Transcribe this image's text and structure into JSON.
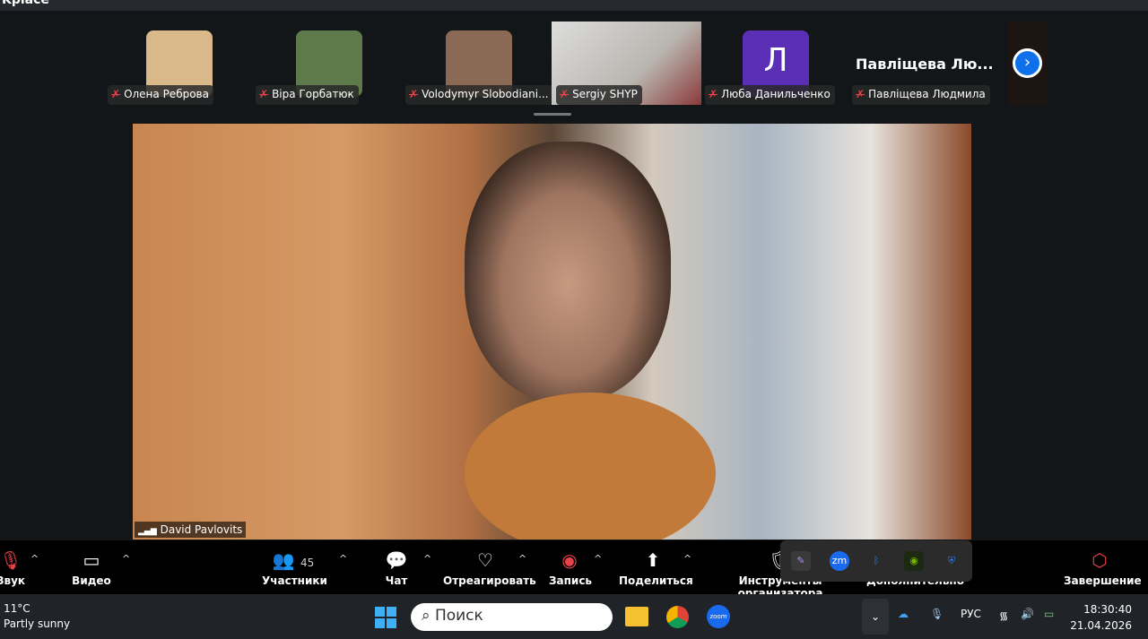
{
  "window": {
    "title": "Kpiace"
  },
  "participants": [
    {
      "name": "Олена Реброва",
      "color": "#d9b98a"
    },
    {
      "name": "Віра Горбатюк",
      "color": "#5e7a4a"
    },
    {
      "name": "Volodymyr Slobodiani...",
      "color": "#8a6a55"
    },
    {
      "name": "Sergiy SHYP",
      "color": "#b9b6b0"
    },
    {
      "name": "Люба Данильченко",
      "initial": "Л",
      "color": "#5a2fb5"
    },
    {
      "name": "Павліщева Людмила",
      "display": "Павліщева Лю..."
    }
  ],
  "mute_icon": "✗",
  "next_icon": "›",
  "main_video": {
    "name": "David Pavlovits",
    "signal": "▂▄▆"
  },
  "toolbar": {
    "audio": "Звук",
    "video": "Видео",
    "participants": "Участники",
    "participants_count": "45",
    "chat": "Чат",
    "react": "Отреагировать",
    "record": "Запись",
    "share": "Поделиться",
    "host_tools": "Инструменты организатора",
    "more": "Дополнительно",
    "end": "Завершение"
  },
  "tray_icons": [
    "feather-icon",
    "zm",
    "bt",
    "nv",
    "defender"
  ],
  "taskbar": {
    "temp": "11°C",
    "weather": "Partly sunny",
    "search": "Поиск",
    "lang": "РУС",
    "time": "18:30:40",
    "date": "21.04.2026"
  }
}
